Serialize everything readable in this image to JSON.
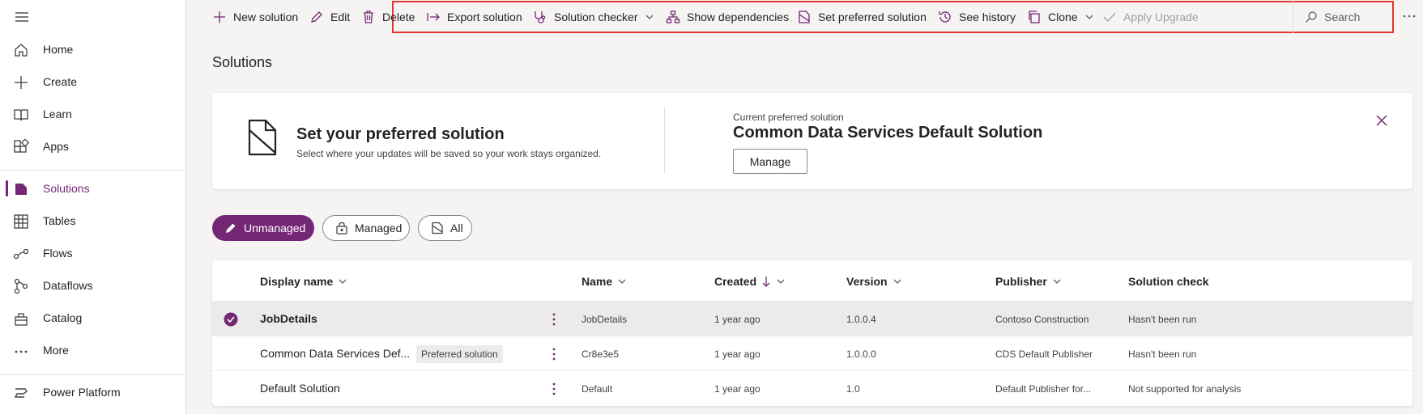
{
  "sidebar": {
    "items": [
      {
        "label": "Home",
        "icon": "home-icon"
      },
      {
        "label": "Create",
        "icon": "plus-icon"
      },
      {
        "label": "Learn",
        "icon": "book-icon"
      },
      {
        "label": "Apps",
        "icon": "apps-icon"
      },
      {
        "label": "Solutions",
        "icon": "solutions-icon",
        "active": true
      },
      {
        "label": "Tables",
        "icon": "table-icon"
      },
      {
        "label": "Flows",
        "icon": "flow-icon"
      },
      {
        "label": "Dataflows",
        "icon": "dataflow-icon"
      },
      {
        "label": "Catalog",
        "icon": "catalog-icon"
      },
      {
        "label": "More",
        "icon": "more-icon"
      },
      {
        "label": "Power Platform",
        "icon": "power-platform-icon"
      }
    ]
  },
  "toolbar": {
    "new_solution": "New solution",
    "edit": "Edit",
    "delete": "Delete",
    "export_solution": "Export solution",
    "solution_checker": "Solution checker",
    "show_dependencies": "Show dependencies",
    "set_preferred": "Set preferred solution",
    "see_history": "See history",
    "clone": "Clone",
    "apply_upgrade": "Apply Upgrade",
    "search_placeholder": "Search"
  },
  "page": {
    "title": "Solutions"
  },
  "banner": {
    "title": "Set your preferred solution",
    "subtitle": "Select where your updates will be saved so your work stays organized.",
    "current_label": "Current preferred solution",
    "current_value": "Common Data Services Default Solution",
    "manage_label": "Manage"
  },
  "filters": {
    "unmanaged": "Unmanaged",
    "managed": "Managed",
    "all": "All"
  },
  "table": {
    "columns": {
      "display_name": "Display name",
      "name": "Name",
      "created": "Created",
      "version": "Version",
      "publisher": "Publisher",
      "solution_check": "Solution check"
    },
    "rows": [
      {
        "display_name": "JobDetails",
        "badge": "",
        "name": "JobDetails",
        "created": "1 year ago",
        "version": "1.0.0.4",
        "publisher": "Contoso Construction",
        "solution_check": "Hasn't been run",
        "selected": true
      },
      {
        "display_name": "Common Data Services Def...",
        "badge": "Preferred solution",
        "name": "Cr8e3e5",
        "created": "1 year ago",
        "version": "1.0.0.0",
        "publisher": "CDS Default Publisher",
        "solution_check": "Hasn't been run",
        "selected": false
      },
      {
        "display_name": "Default Solution",
        "badge": "",
        "name": "Default",
        "created": "1 year ago",
        "version": "1.0",
        "publisher": "Default Publisher for...",
        "solution_check": "Not supported for analysis",
        "selected": false
      }
    ]
  },
  "colors": {
    "accent": "#742774",
    "highlight_border": "#e2372f",
    "background": "#f5f4f3"
  }
}
